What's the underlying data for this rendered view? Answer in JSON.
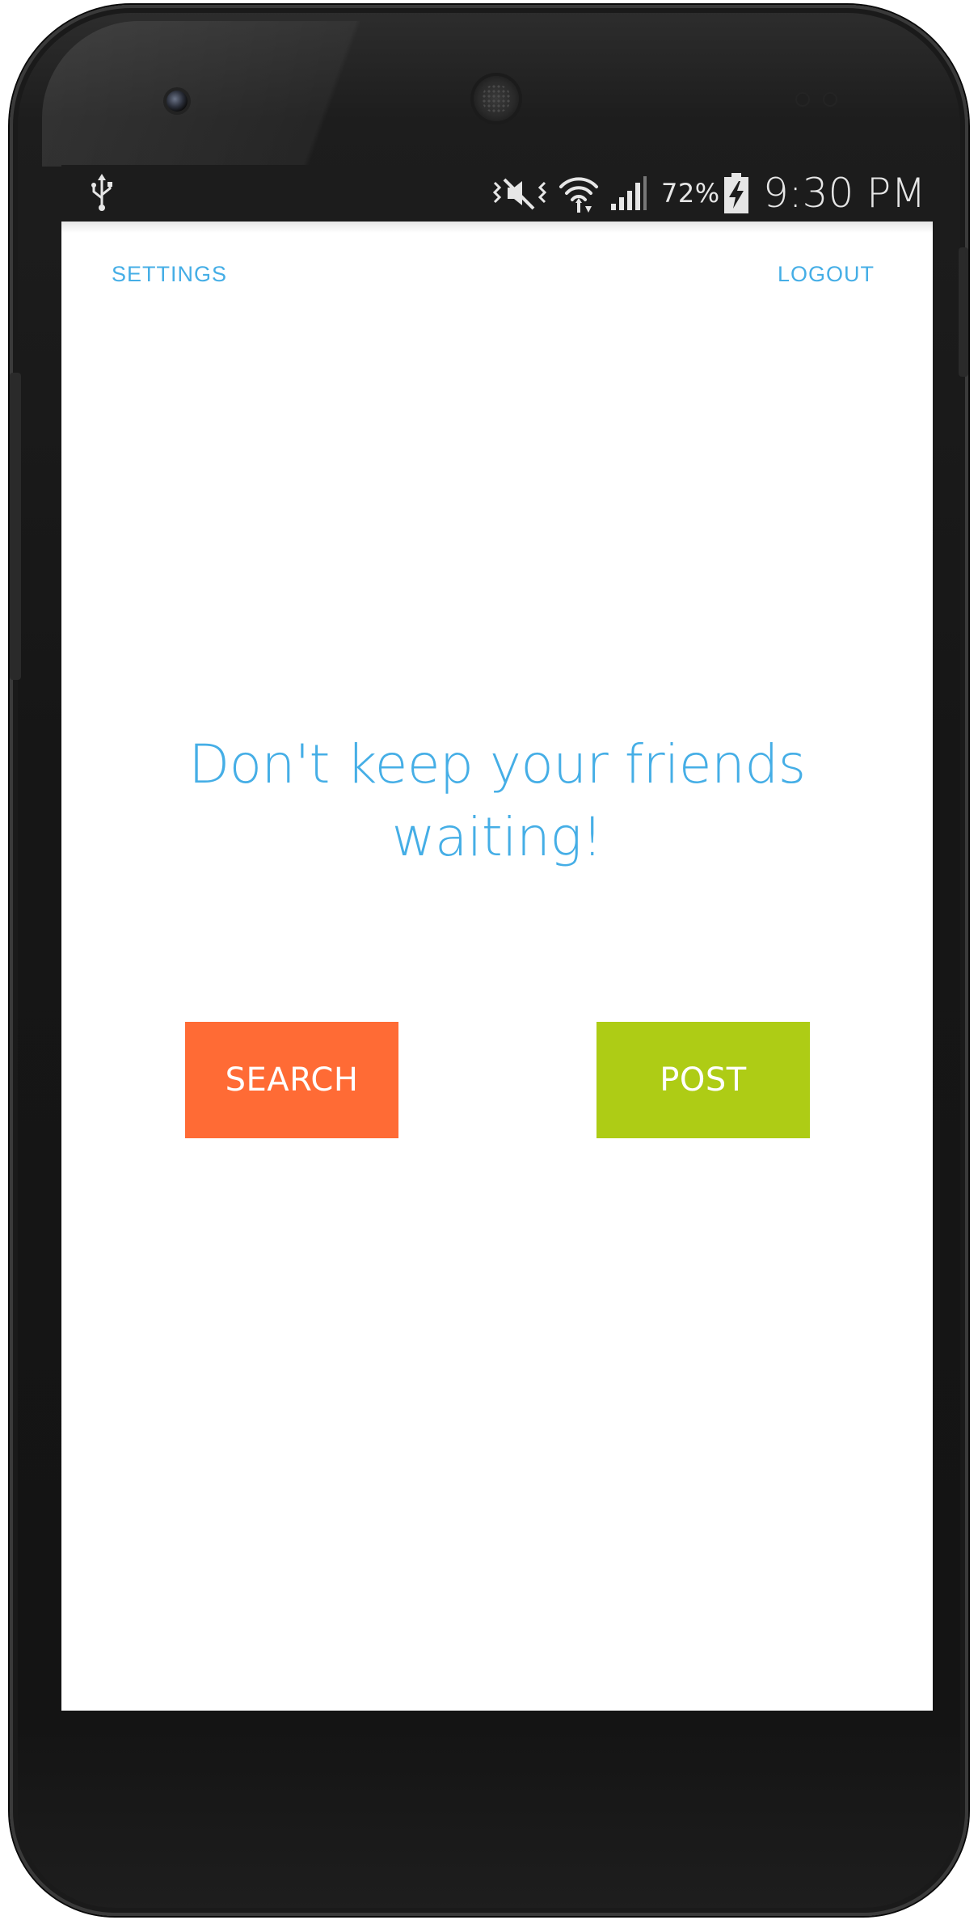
{
  "status_bar": {
    "battery_percent": "72%",
    "time": "9:30 PM",
    "icons": [
      "usb-icon",
      "vibrate-mute-icon",
      "wifi-icon",
      "cell-signal-icon",
      "battery-charging-icon"
    ]
  },
  "top_nav": {
    "settings_label": "SETTINGS",
    "logout_label": "LOGOUT"
  },
  "main": {
    "headline_line1": "Don't keep your friends",
    "headline_line2": "waiting!"
  },
  "actions": {
    "search_label": "SEARCH",
    "post_label": "POST"
  },
  "colors": {
    "accent_blue": "#45aee6",
    "search_orange": "#ff6b35",
    "post_green": "#aecc15",
    "status_bar": "#1c1c1c"
  }
}
